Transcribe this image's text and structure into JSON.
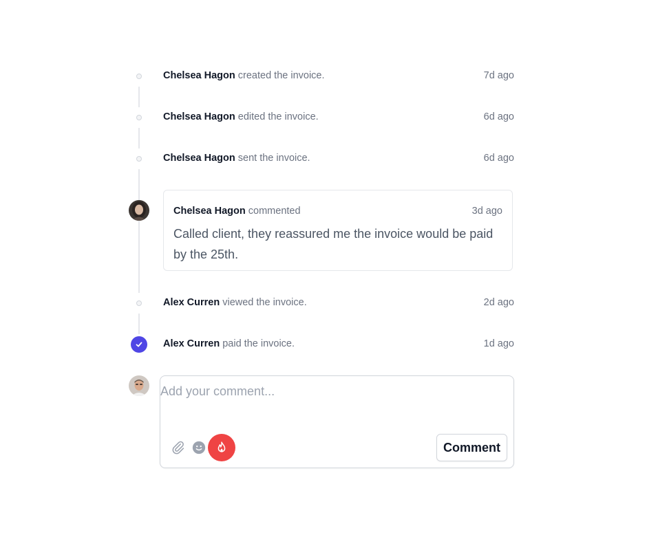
{
  "activity": [
    {
      "who": "Chelsea Hagon",
      "action": "created the invoice.",
      "time": "7d ago"
    },
    {
      "who": "Chelsea Hagon",
      "action": "edited the invoice.",
      "time": "6d ago"
    },
    {
      "who": "Chelsea Hagon",
      "action": "sent the invoice.",
      "time": "6d ago"
    },
    {
      "who": "Alex Curren",
      "action": "viewed the invoice.",
      "time": "2d ago"
    },
    {
      "who": "Alex Curren",
      "action": "paid the invoice.",
      "time": "1d ago"
    }
  ],
  "comment": {
    "who": "Chelsea Hagon",
    "verb": "commented",
    "time": "3d ago",
    "body": "Called client, they reassured me the invoice would be paid by the 25th."
  },
  "composer": {
    "placeholder": "Add your comment...",
    "submit_label": "Comment",
    "icons": [
      "paperclip-icon",
      "smiley-icon",
      "fire-icon"
    ]
  },
  "colors": {
    "accent": "#4f46e5",
    "mood": "#ef4444",
    "line": "#e5e7eb"
  }
}
